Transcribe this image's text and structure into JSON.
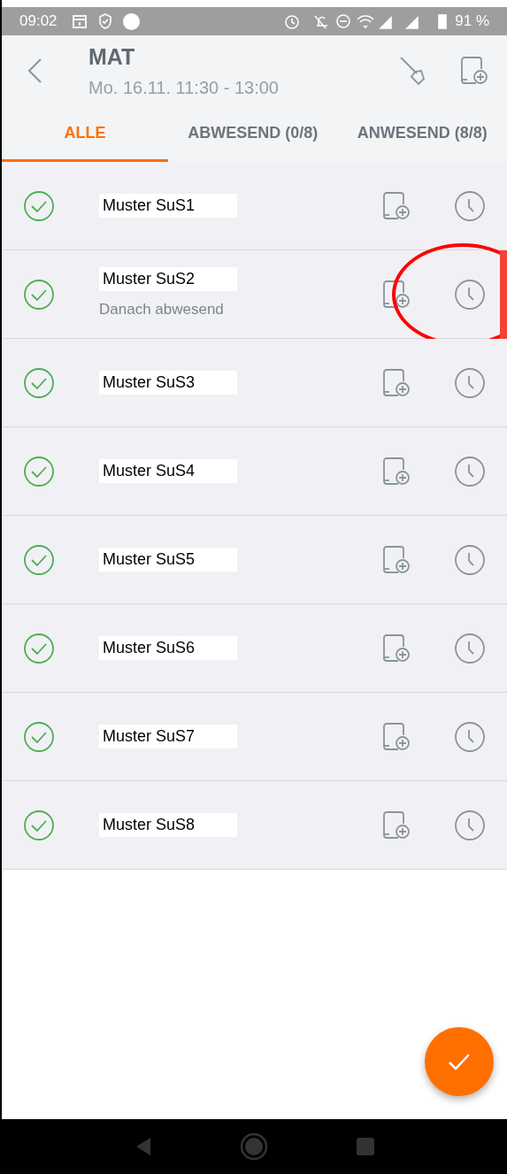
{
  "status_bar": {
    "time": "09:02",
    "battery": "91 %"
  },
  "header": {
    "title": "MAT",
    "subtitle": "Mo. 16.11. 11:30 - 13:00"
  },
  "tabs": [
    {
      "label": "ALLE",
      "selected": true
    },
    {
      "label": "ABWESEND (0/8)",
      "selected": false
    },
    {
      "label": "ANWESEND (8/8)",
      "selected": false
    }
  ],
  "students": [
    {
      "name": "Muster SuS1",
      "present": true
    },
    {
      "name": "Muster SuS2",
      "note": "Danach abwesend",
      "present": true,
      "annotated": true
    },
    {
      "name": "Muster SuS3",
      "present": true
    },
    {
      "name": "Muster SuS4",
      "present": true
    },
    {
      "name": "Muster SuS5",
      "present": true
    },
    {
      "name": "Muster SuS6",
      "present": true
    },
    {
      "name": "Muster SuS7",
      "present": true
    },
    {
      "name": "Muster SuS8",
      "present": true
    }
  ]
}
